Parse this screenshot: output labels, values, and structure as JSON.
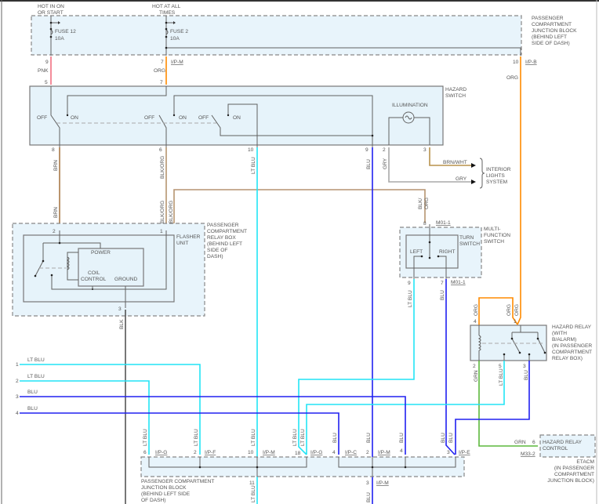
{
  "wire_colors": {
    "PNK": "#f07080",
    "ORG": "#ff8a00",
    "BRN": "#a87a48",
    "BLK_ORG": "#b59470",
    "LT_BLU": "#22e4f5",
    "BLU": "#2020f0",
    "GRY": "#a8a8a8",
    "BRN_WHT": "#b8924c",
    "GRN": "#5cb83c",
    "BLK": "#555555"
  },
  "top_jb": {
    "label": [
      "PASSENGER",
      "COMPARTMENT",
      "JUNCTION BLOCK",
      "(BEHIND LEFT",
      "SIDE OF DASH)"
    ],
    "feed_on": [
      "HOT IN ON",
      "OR START"
    ],
    "feed_all": [
      "HOT AT ALL",
      "TIMES"
    ],
    "fuse12": "FUSE 12",
    "fuse12_rating": "10A",
    "fuse2": "FUSE 2",
    "fuse2_rating": "10A",
    "pin_9": "9",
    "pin_7": "7",
    "pin_10": "10",
    "conn_ipm": "I/P-M",
    "conn_ipb": "I/P-B"
  },
  "wires_top": {
    "pnk": "PNK",
    "org": "ORG",
    "org_right": "ORG"
  },
  "hazard_switch": {
    "label": [
      "HAZARD",
      "SWITCH"
    ],
    "pin_5": "5",
    "pin_7": "7",
    "off": "OFF",
    "on": "ON",
    "illumination": "ILLUMINATION",
    "pin_8": "8",
    "pin_6": "6",
    "pin_10": "10",
    "pin_9": "9",
    "pin_2": "2",
    "pin_3": "3"
  },
  "wires_mid": {
    "brn": "BRN",
    "blk_org": "BLK/ORG",
    "lt_blu": "LT BLU",
    "blu": "BLU",
    "gry": "GRY",
    "brn_wht": "BRN/WHT",
    "gry_h": "GRY",
    "brn2": "BRN",
    "blk_org2": "BLK/ORG",
    "blk_org3": "BLK/ORG",
    "blk_org_mf": [
      "BLK/",
      "ORG"
    ],
    "blk": "BLK"
  },
  "interior_lights": [
    "INTERIOR",
    "LIGHTS",
    "SYSTEM"
  ],
  "relay_box": {
    "label": [
      "PASSENGER",
      "COMPARTMENT",
      "RELAY BOX",
      "(BEHIND LEFT",
      "SIDE OF",
      "DASH)"
    ],
    "flasher": [
      "FLASHER",
      "UNIT"
    ],
    "power": "POWER",
    "coil": "COIL",
    "control": "CONTROL",
    "ground": "GROUND",
    "pin_2": "2",
    "pin_1": "1",
    "pin_3": "3"
  },
  "multifunction": {
    "label": [
      "MULTI-",
      "FUNCTION",
      "SWITCH"
    ],
    "turn": [
      "TURN",
      "SWITCH"
    ],
    "left": "LEFT",
    "right": "RIGHT",
    "pin_8": "8",
    "pin_9": "9",
    "pin_7": "7",
    "conn": "M01-1",
    "conn_bottom": "M01-1",
    "wire_lt_blu": "LT BLU",
    "wire_blu": "BLU"
  },
  "hazard_relay": {
    "label": [
      "HAZARD RELAY",
      "(WITH",
      "B/ALARM)",
      "(IN PASSENGER",
      "COMPARTMENT",
      "RELAY BOX)"
    ],
    "pin_4": "4",
    "pin_1": "1",
    "pin_2": "2",
    "pin_5": "5",
    "pin_3": "3",
    "wire_org1": "ORG",
    "wire_org2": "ORG",
    "wire_org3": "ORG",
    "wire_grn": "GRN",
    "wire_lt_blu": "LT BLU",
    "wire_blu": "BLU"
  },
  "left_wires": [
    {
      "num": "1",
      "color": "LT BLU"
    },
    {
      "num": "2",
      "color": "LT BLU"
    },
    {
      "num": "3",
      "color": "BLU"
    },
    {
      "num": "4",
      "color": "BLU"
    }
  ],
  "bottom_jb": {
    "label": [
      "PASSENGER COMPARTMENT",
      "JUNCTION BLOCK",
      "(BEHIND LEFT SIDE",
      "OF DASH)"
    ],
    "pins": [
      {
        "pin": "6",
        "conn": "I/P-G",
        "wire": "LT BLU"
      },
      {
        "pin": "2",
        "conn": "I/P-F",
        "wire": "LT BLU"
      },
      {
        "pin": "10",
        "conn": "I/P-M",
        "wire": "LT BLU"
      },
      {
        "pin": "18",
        "conn": "I/P-G",
        "wire": "LT BLU",
        "wire2": "LT BLU"
      },
      {
        "pin": "4",
        "conn": "I/P-C",
        "wire": "BLU"
      },
      {
        "pin": "2",
        "conn": "I/P-M",
        "wire": "BLU"
      },
      {
        "pin": "4",
        "wire": "BLU"
      },
      {
        "pin": "3",
        "conn": "I/P-E",
        "wire": "BLU",
        "wire2": "BLU"
      }
    ],
    "out_11": "11",
    "out_11_wire": "LT BLU",
    "out_3": "3",
    "out_3_conn": "I/P-M",
    "out_3_wire": "BLU"
  },
  "etacm": {
    "label": [
      "HAZARD RELAY",
      "CONTROL"
    ],
    "wire": "GRN",
    "pin": "6",
    "conn": "M33-2",
    "sub": [
      "ETACM",
      "(IN PASSENGER",
      "COMPARTMENT",
      "JUNCTION BLOCK)"
    ]
  }
}
